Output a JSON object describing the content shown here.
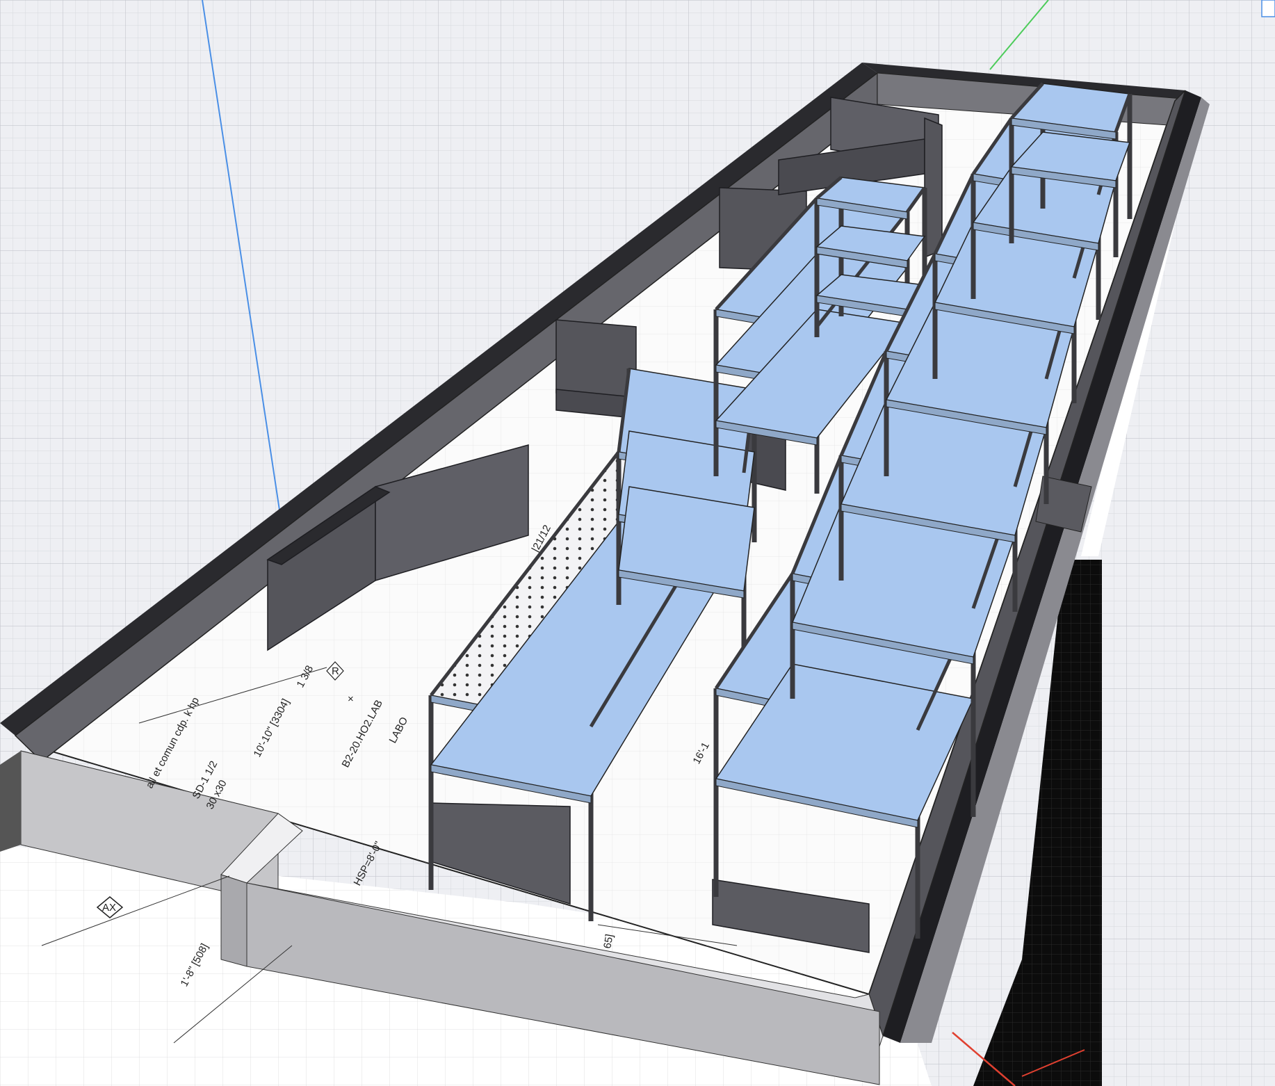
{
  "plan_labels": {
    "room_id": "B2-20.HO2.LAB",
    "room_name": "LABO",
    "dim_width": "10'-10\" [3304]",
    "hsp": "HSP=8'-0\"",
    "dim_left": "1'-8\" [508]",
    "dim_small": "65]",
    "grid_tag": "AX",
    "tag_r": "R",
    "note_top": "all et comun  cdp. k hp",
    "note_b": "SD-1 1/2",
    "note_c": "30 x30",
    "note_d": "1 3/8",
    "note_e": "×",
    "note_f": "|21/12",
    "note_g": "16'-1"
  },
  "colors": {
    "grid_bg": "#eeeff3",
    "wall_top": "#2a2a2e",
    "wall_face": "#6a6a70",
    "shelf_panel": "#a9c7ef",
    "rack_frame": "#3a3a3e",
    "axis_blue": "#4a8fe6",
    "axis_green": "#4ccc5a",
    "axis_red": "#e04030"
  },
  "icons": {
    "origin_marker": "corner-marker-icon"
  }
}
